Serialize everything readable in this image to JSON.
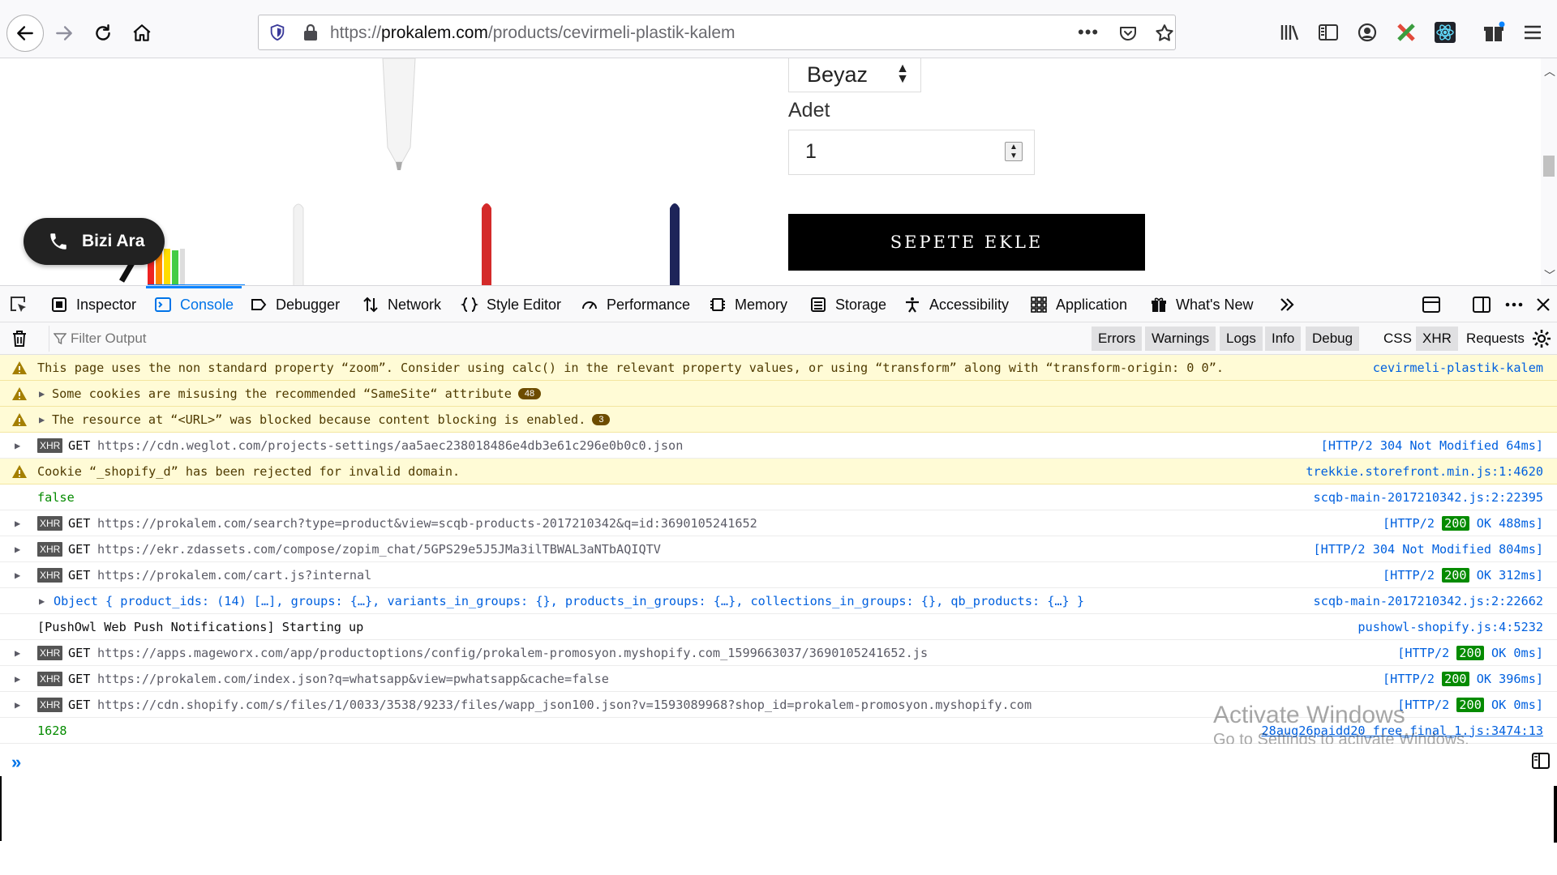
{
  "browser": {
    "url_prefix": "https://",
    "url_domain": "prokalem.com",
    "url_path": "/products/cevirmeli-plastik-kalem",
    "url_more": "•••"
  },
  "page": {
    "color_select_value": "Beyaz",
    "quantity_label": "Adet",
    "quantity_value": "1",
    "add_to_cart_label": "SEPETE EKLE",
    "call_button_label": "Bizi Ara"
  },
  "devtools": {
    "tabs": [
      {
        "label": "Inspector",
        "icon": "inspector-icon"
      },
      {
        "label": "Console",
        "icon": "console-icon",
        "active": true
      },
      {
        "label": "Debugger",
        "icon": "debugger-icon"
      },
      {
        "label": "Network",
        "icon": "network-icon"
      },
      {
        "label": "Style Editor",
        "icon": "style-editor-icon"
      },
      {
        "label": "Performance",
        "icon": "performance-icon"
      },
      {
        "label": "Memory",
        "icon": "memory-icon"
      },
      {
        "label": "Storage",
        "icon": "storage-icon"
      },
      {
        "label": "Accessibility",
        "icon": "accessibility-icon"
      },
      {
        "label": "Application",
        "icon": "application-icon"
      },
      {
        "label": "What's New",
        "icon": "gift-icon"
      }
    ],
    "filter_placeholder": "Filter Output",
    "filters": [
      "Errors",
      "Warnings",
      "Logs",
      "Info",
      "Debug",
      "CSS",
      "XHR",
      "Requests"
    ],
    "messages": [
      {
        "type": "warn",
        "text": "This page uses the non standard property “zoom”. Consider using calc() in the relevant property values, or using “transform” along with “transform-origin: 0 0”.",
        "source": "cevirmeli-plastik-kalem"
      },
      {
        "type": "warn-group",
        "text": "Some cookies are misusing the recommended “SameSite“ attribute",
        "count": "48"
      },
      {
        "type": "warn-group",
        "text": "The resource at “<URL>” was blocked because content blocking is enabled.",
        "count": "3"
      },
      {
        "type": "xhr",
        "method": "GET",
        "url": "https://cdn.weglot.com/projects-settings/aa5aec238018486e4db3e61c296e0b0c0.json",
        "status_pre": "[HTTP/2 ",
        "status_code": "304",
        "status_post": " Not Modified 64ms]"
      },
      {
        "type": "warn",
        "text": "Cookie “_shopify_d” has been rejected for invalid domain.",
        "source": "trekkie.storefront.min.js:1:4620"
      },
      {
        "type": "log-false",
        "text": "false",
        "source": "scqb-main-2017210342.js:2:22395"
      },
      {
        "type": "xhr",
        "method": "GET",
        "url": "https://prokalem.com/search?type=product&view=scqb-products-2017210342&q=id:3690105241652",
        "status_pre": "[HTTP/2 ",
        "status_code": "200",
        "status_post": " OK 488ms]"
      },
      {
        "type": "xhr",
        "method": "GET",
        "url": "https://ekr.zdassets.com/compose/zopim_chat/5GPS29e5J5JMa3ilTBWAL3aNTbAQIQTV",
        "status_pre": "[HTTP/2 ",
        "status_code": "304",
        "status_post": " Not Modified 804ms]"
      },
      {
        "type": "xhr",
        "method": "GET",
        "url": "https://prokalem.com/cart.js?internal",
        "status_pre": "[HTTP/2 ",
        "status_code": "200",
        "status_post": " OK 312ms]"
      },
      {
        "type": "object",
        "text": "Object { product_ids: (14) […], groups: {…}, variants_in_groups: {}, products_in_groups: {…}, collections_in_groups: {}, qb_products: {…} }",
        "source": "scqb-main-2017210342.js:2:22662"
      },
      {
        "type": "log",
        "text": "[PushOwl Web Push Notifications] Starting up",
        "source": "pushowl-shopify.js:4:5232"
      },
      {
        "type": "xhr",
        "method": "GET",
        "url": "https://apps.mageworx.com/app/productoptions/config/prokalem-promosyon.myshopify.com_1599663037/3690105241652.js",
        "status_pre": "[HTTP/2 ",
        "status_code": "200",
        "status_post": " OK 0ms]"
      },
      {
        "type": "xhr",
        "method": "GET",
        "url": "https://prokalem.com/index.json?q=whatsapp&view=pwhatsapp&cache=false",
        "status_pre": "[HTTP/2 ",
        "status_code": "200",
        "status_post": " OK 396ms]"
      },
      {
        "type": "xhr",
        "method": "GET",
        "url": "https://cdn.shopify.com/s/files/1/0033/3538/9233/files/wapp_json100.json?v=1593089968?shop_id=prokalem-promosyon.myshopify.com",
        "status_pre": "[HTTP/2 ",
        "status_code": "200",
        "status_post": " OK 0ms]"
      },
      {
        "type": "log-num",
        "text": "1628",
        "source": "28aug26paidd20_free_final_1.js:3474:13"
      }
    ],
    "xhr_badge": "XHR"
  },
  "watermark": {
    "line1": "Activate Windows",
    "line2": "Go to Settings to activate Windows."
  }
}
